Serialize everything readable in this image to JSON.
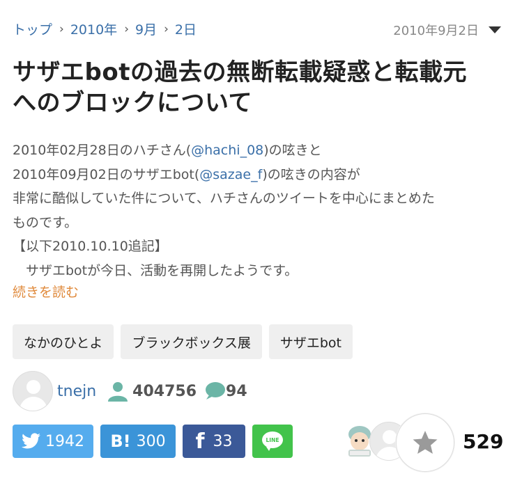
{
  "breadcrumb": {
    "items": [
      "トップ",
      "2010年",
      "9月",
      "2日"
    ],
    "date": "2010年9月2日"
  },
  "article": {
    "title_line1": "サザエbotの過去の無断転載疑惑と転載元",
    "title_line2": "へのブロックについて",
    "excerpt": {
      "line1_pre": "2010年02月28日のハチさん(",
      "line1_mention": "@hachi_08",
      "line1_post": ")の呟きと",
      "line2_pre": "2010年09月02日のサザエbot(",
      "line2_mention": "@sazae_f",
      "line2_post": ")の呟きの内容が",
      "line3": "非常に酷似していた件について、ハチさんのツイートを中心にまとめた",
      "line4": "ものです。",
      "line5": "【以下2010.10.10追記】",
      "line6": "　サザエbotが今日、活動を再開したようです。"
    },
    "read_more": "続きを読む"
  },
  "tags": [
    "なかのひとよ",
    "ブラックボックス展",
    "サザエbot"
  ],
  "author": {
    "name": "tnejn",
    "views": "404756",
    "comments": "94"
  },
  "shares": {
    "twitter": "1942",
    "hatena_icon": "B!",
    "hatena": "300",
    "facebook_icon": "f",
    "facebook": "33",
    "line_icon": "LINE"
  },
  "favorites": {
    "count": "529"
  },
  "colors": {
    "link": "#3a6fa8",
    "read_more": "#e08a3c",
    "twitter": "#55acee",
    "hatena": "#3b94d8",
    "facebook": "#3b5998",
    "line": "#42c34b"
  }
}
